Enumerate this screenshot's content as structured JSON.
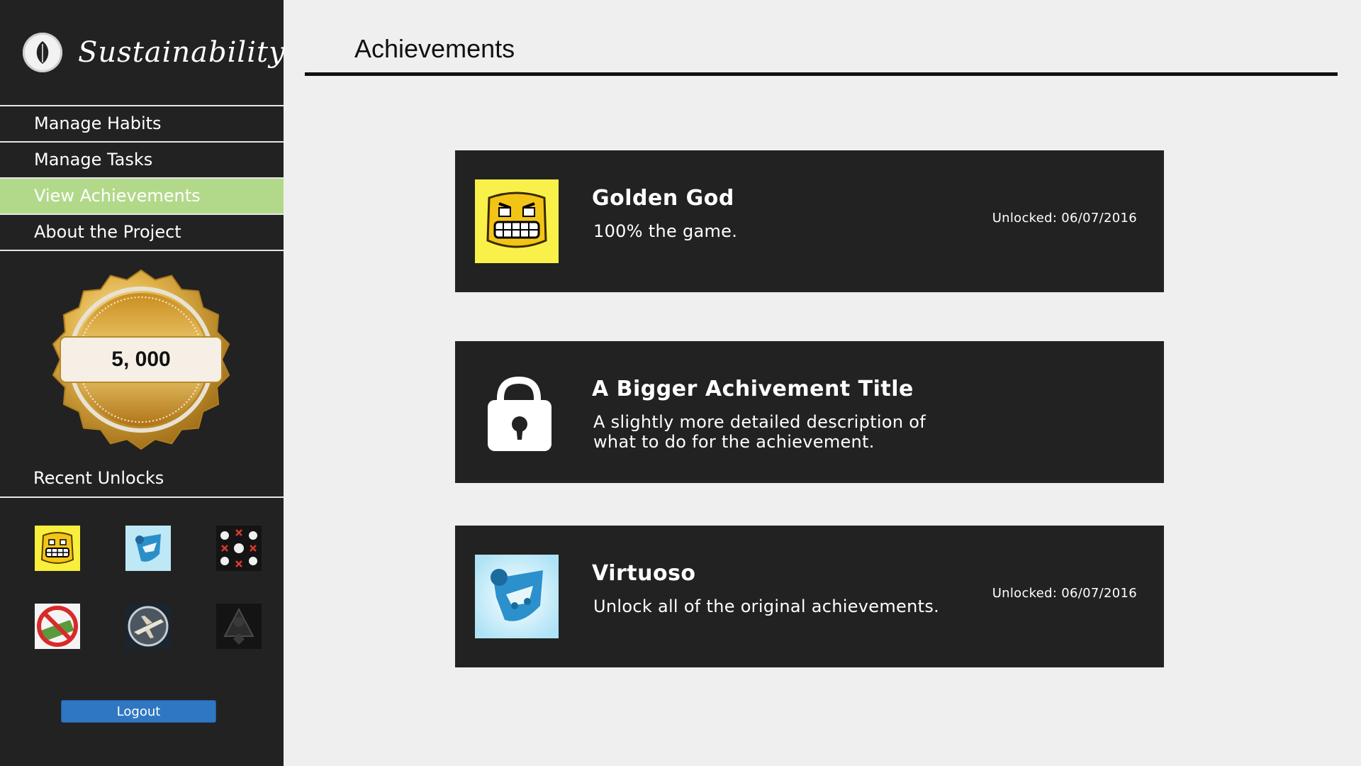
{
  "app": {
    "title": "Sustainability"
  },
  "sidebar": {
    "nav": [
      {
        "label": "Manage Habits",
        "active": false
      },
      {
        "label": "Manage Tasks",
        "active": false
      },
      {
        "label": "View Achievements",
        "active": true
      },
      {
        "label": "About the Project",
        "active": false
      }
    ],
    "points": "5, 000",
    "recent_title": "Recent Unlocks",
    "recent_icons": [
      "grinning-yellow-face-icon",
      "rocket-league-shield-icon",
      "skulls-pattern-icon",
      "no-money-icon",
      "plane-badge-icon",
      "dark-emblem-icon"
    ],
    "logout_label": "Logout"
  },
  "main": {
    "title": "Achievements",
    "achievements": [
      {
        "title": "Golden God",
        "description": "100% the game.",
        "unlocked": "Unlocked: 06/07/2016",
        "icon": "grinning-yellow-face-icon",
        "locked": false
      },
      {
        "title": "A Bigger Achivement Title",
        "description": "A slightly more detailed description of what to do for the achievement.",
        "unlocked": "",
        "icon": "padlock-icon",
        "locked": true
      },
      {
        "title": "Virtuoso",
        "description": "Unlock all of the original achievements.",
        "unlocked": "Unlocked: 06/07/2016",
        "icon": "rocket-league-shield-icon",
        "locked": false
      }
    ]
  },
  "colors": {
    "sidebar_bg": "#222222",
    "page_bg": "#efefef",
    "card_bg": "#222222",
    "active_nav": "#b2d98a",
    "logout_button": "#2f77c1",
    "medal_gold": "#d4a63a"
  }
}
